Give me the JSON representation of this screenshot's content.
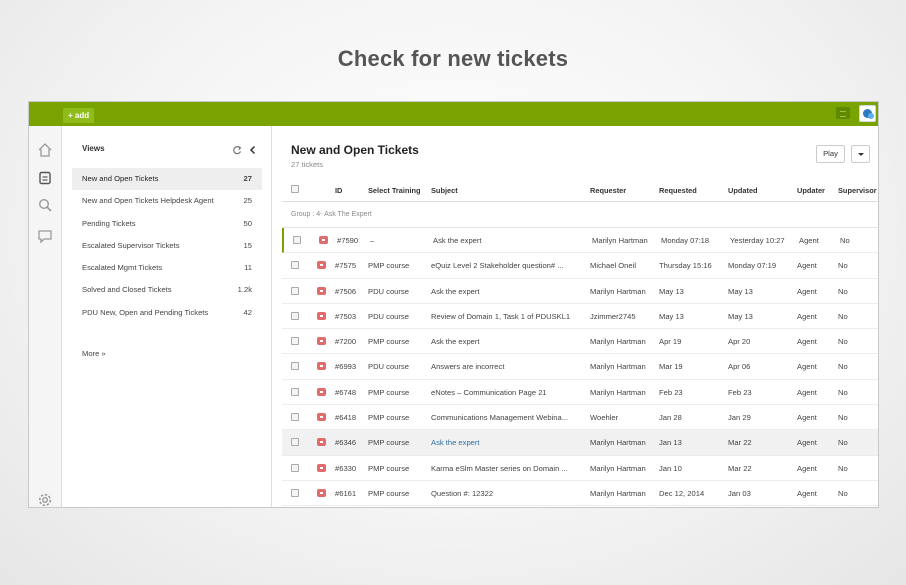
{
  "caption": "Check for new tickets",
  "topbar": {
    "add_label": "+ add"
  },
  "views": {
    "title": "Views",
    "items": [
      {
        "label": "New and Open Tickets",
        "count": "27"
      },
      {
        "label": "New and Open Tickets Helpdesk Agent",
        "count": "25"
      },
      {
        "label": "Pending Tickets",
        "count": "50"
      },
      {
        "label": "Escalated Supervisor Tickets",
        "count": "15"
      },
      {
        "label": "Escalated Mgmt Tickets",
        "count": "11"
      },
      {
        "label": "Solved and Closed Tickets",
        "count": "1.2k"
      },
      {
        "label": "PDU New, Open and Pending Tickets",
        "count": "42"
      }
    ],
    "more_label": "More »"
  },
  "main": {
    "title": "New and Open Tickets",
    "count_label": "27 tickets",
    "play_label": "Play",
    "columns": [
      "ID",
      "Select Training",
      "Subject",
      "Requester",
      "Requested",
      "Updated",
      "Updater",
      "Supervisor"
    ],
    "group_label": "Group : 4- Ask The Expert",
    "rows": [
      {
        "id": "#7590",
        "training": "–",
        "subject": "Ask the expert",
        "requester": "Marilyn Hartman",
        "requested": "Monday 07:18",
        "updated": "Yesterday 10:27",
        "updater": "Agent",
        "supervisor": "No"
      },
      {
        "id": "#7575",
        "training": "PMP course",
        "subject": "eQuiz Level 2 Stakeholder question# ...",
        "requester": "Michael Oneil",
        "requested": "Thursday 15:16",
        "updated": "Monday 07:19",
        "updater": "Agent",
        "supervisor": "No"
      },
      {
        "id": "#7506",
        "training": "PDU course",
        "subject": "Ask the expert",
        "requester": "Marilyn Hartman",
        "requested": "May 13",
        "updated": "May 13",
        "updater": "Agent",
        "supervisor": "No"
      },
      {
        "id": "#7503",
        "training": "PDU course",
        "subject": "Review of Domain 1, Task 1 of PDUSKL1",
        "requester": "Jzimmer2745",
        "requested": "May 13",
        "updated": "May 13",
        "updater": "Agent",
        "supervisor": "No"
      },
      {
        "id": "#7200",
        "training": "PMP course",
        "subject": "Ask the expert",
        "requester": "Marilyn Hartman",
        "requested": "Apr 19",
        "updated": "Apr 20",
        "updater": "Agent",
        "supervisor": "No"
      },
      {
        "id": "#6993",
        "training": "PDU course",
        "subject": "Answers are incorrect",
        "requester": "Marilyn Hartman",
        "requested": "Mar 19",
        "updated": "Apr 06",
        "updater": "Agent",
        "supervisor": "No"
      },
      {
        "id": "#6748",
        "training": "PMP course",
        "subject": "eNotes – Communication Page 21",
        "requester": "Marilyn Hartman",
        "requested": "Feb 23",
        "updated": "Feb 23",
        "updater": "Agent",
        "supervisor": "No"
      },
      {
        "id": "#6418",
        "training": "PMP course",
        "subject": "Communications Management Webina...",
        "requester": "Woehler",
        "requested": "Jan 28",
        "updated": "Jan 29",
        "updater": "Agent",
        "supervisor": "No"
      },
      {
        "id": "#6346",
        "training": "PMP course",
        "subject": "Ask the expert",
        "requester": "Marilyn Hartman",
        "requested": "Jan 13",
        "updated": "Mar 22",
        "updater": "Agent",
        "supervisor": "No"
      },
      {
        "id": "#6330",
        "training": "PMP course",
        "subject": "Karma eSlm Master series on Domain ...",
        "requester": "Marilyn Hartman",
        "requested": "Jan 10",
        "updated": "Mar 22",
        "updater": "Agent",
        "supervisor": "No"
      },
      {
        "id": "#6161",
        "training": "PMP course",
        "subject": "Question #: 12322",
        "requester": "Marilyn Hartman",
        "requested": "Dec 12, 2014",
        "updated": "Jan 03",
        "updater": "Agent",
        "supervisor": "No"
      }
    ]
  },
  "colors": {
    "topbar": "#78a300",
    "priority": "#e26b6b",
    "link": "#2d6ea5"
  }
}
